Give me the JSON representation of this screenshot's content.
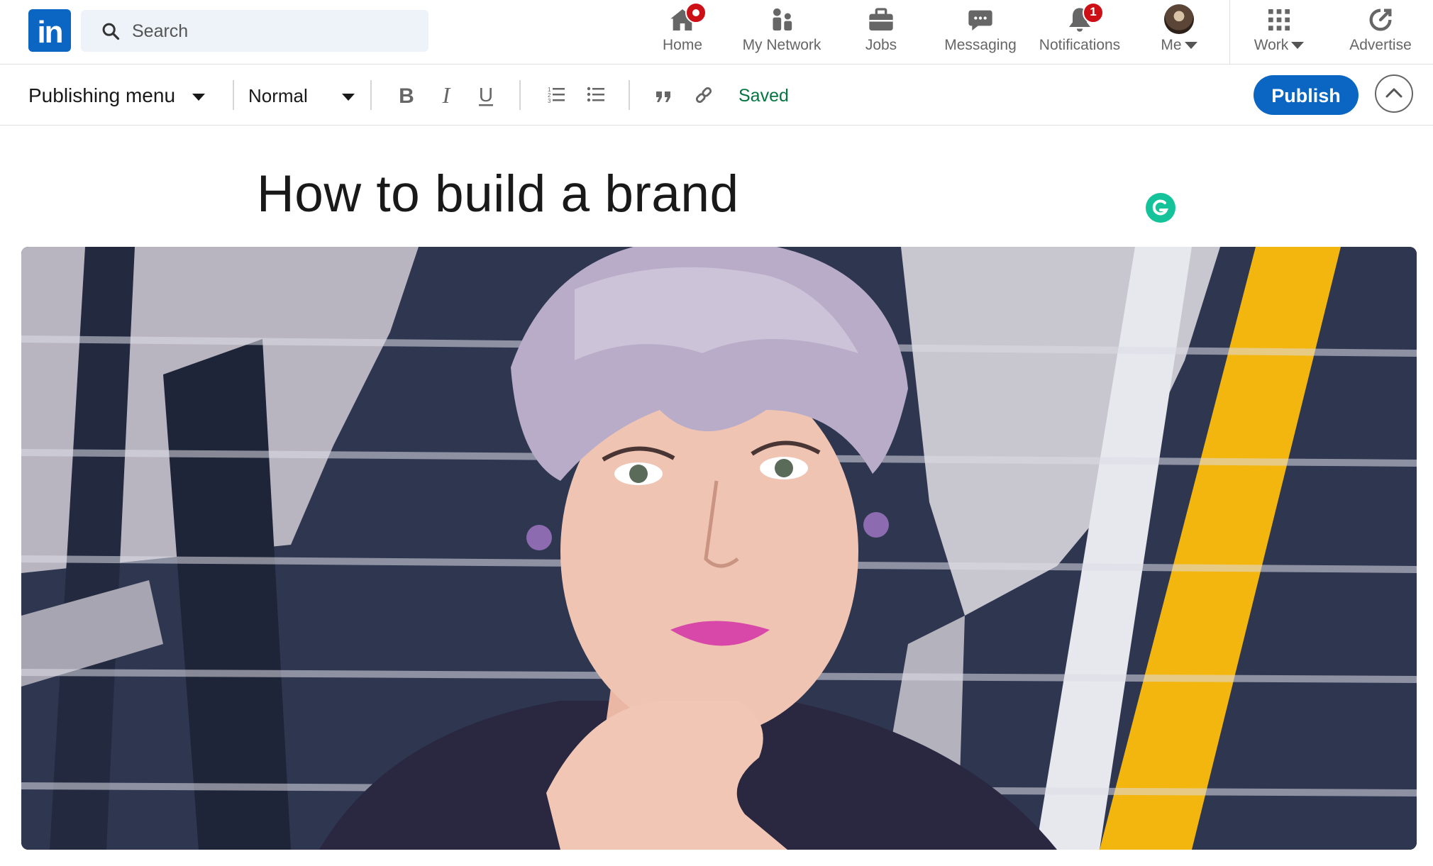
{
  "nav": {
    "logo": "in",
    "search_placeholder": "Search",
    "items": [
      {
        "label": "Home"
      },
      {
        "label": "My Network"
      },
      {
        "label": "Jobs"
      },
      {
        "label": "Messaging"
      },
      {
        "label": "Notifications",
        "badge": "1"
      },
      {
        "label": "Me"
      },
      {
        "label": "Work"
      },
      {
        "label": "Advertise"
      }
    ]
  },
  "toolbar": {
    "menu_label": "Publishing menu",
    "text_style": "Normal",
    "save_status": "Saved",
    "publish_label": "Publish",
    "buttons": [
      "bold-icon",
      "italic-icon",
      "underline-icon",
      "numbered-list-icon",
      "bulleted-list-icon",
      "quote-icon",
      "link-icon"
    ]
  },
  "article": {
    "title": "How to build a brand",
    "cover_image": "woman-with-lilac-hair-against-graffiti-wall"
  },
  "colors": {
    "brand": "#0a66c2",
    "badge": "#cc1016",
    "saved": "#057642",
    "grammarly": "#15c39a"
  }
}
